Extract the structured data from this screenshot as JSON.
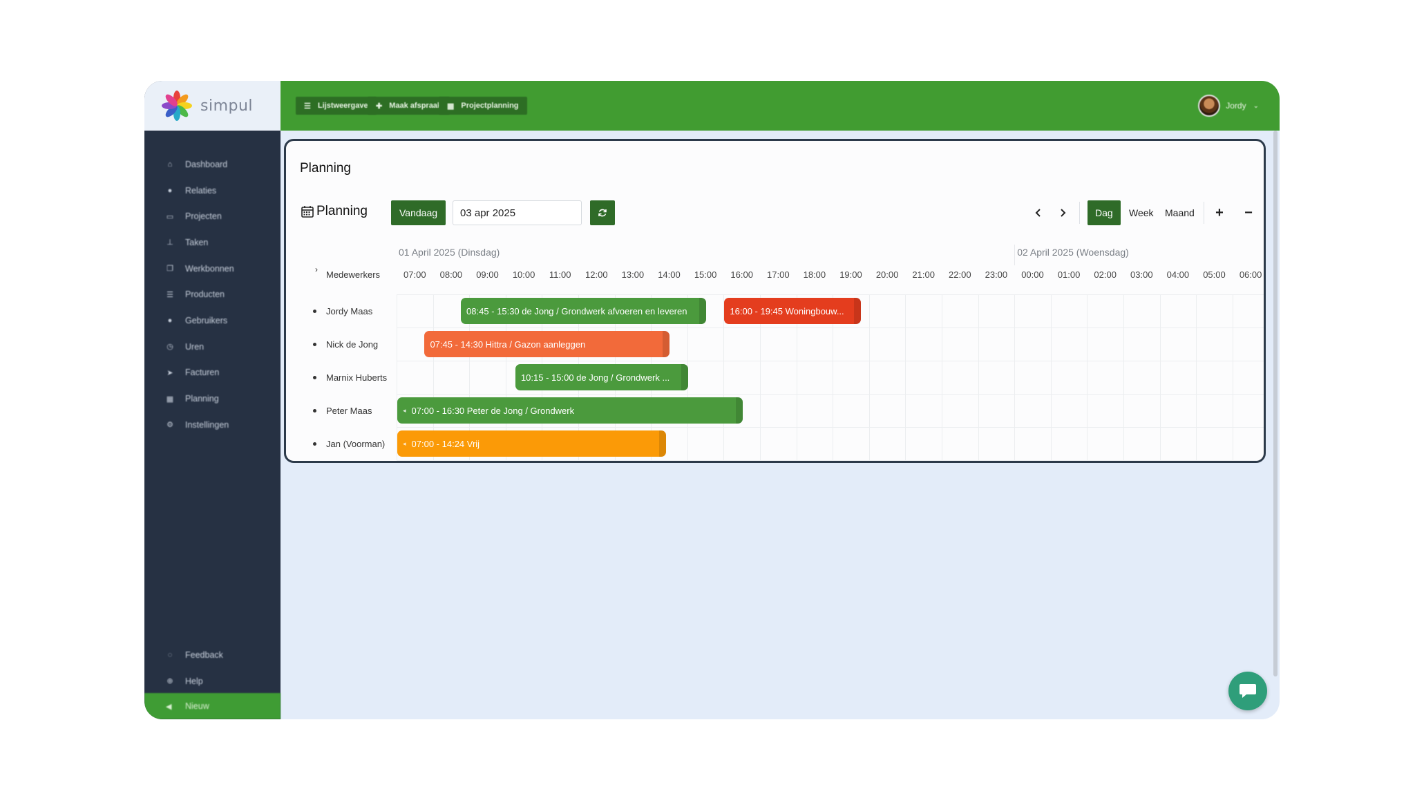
{
  "brand": {
    "name": "simpul"
  },
  "topbar": {
    "buttons": [
      {
        "label": "Lijstweergave",
        "icon": "list-icon"
      },
      {
        "label": "Maak afspraak",
        "icon": "plus-icon"
      },
      {
        "label": "Projectplanning",
        "icon": "calendar-icon"
      }
    ],
    "user": {
      "name": "Jordy"
    }
  },
  "sidebar": {
    "items": [
      {
        "label": "Dashboard",
        "icon": "home-icon"
      },
      {
        "label": "Relaties",
        "icon": "user-icon"
      },
      {
        "label": "Projecten",
        "icon": "inbox-icon"
      },
      {
        "label": "Taken",
        "icon": "pin-icon"
      },
      {
        "label": "Werkbonnen",
        "icon": "copy-icon"
      },
      {
        "label": "Producten",
        "icon": "list-icon"
      },
      {
        "label": "Gebruikers",
        "icon": "users-icon"
      },
      {
        "label": "Uren",
        "icon": "clock-icon"
      },
      {
        "label": "Facturen",
        "icon": "send-icon"
      },
      {
        "label": "Planning",
        "icon": "calendar-icon"
      },
      {
        "label": "Instellingen",
        "icon": "gear-icon"
      }
    ],
    "bottom": [
      {
        "label": "Feedback",
        "icon": "chat-icon"
      },
      {
        "label": "Help",
        "icon": "help-icon"
      }
    ],
    "new": {
      "label": "Nieuw",
      "icon": "megaphone-icon"
    }
  },
  "page": {
    "title": "Planning"
  },
  "toolbar": {
    "title": "Planning",
    "today": "Vandaag",
    "date": "03 apr 2025",
    "views": {
      "day": "Dag",
      "week": "Week",
      "month": "Maand"
    },
    "active_view": "Dag"
  },
  "scheduler": {
    "resource_header": "Medewerkers",
    "days": [
      "01 April 2025 (Dinsdag)",
      "02 April 2025 (Woensdag)"
    ],
    "hours": [
      "07:00",
      "08:00",
      "09:00",
      "10:00",
      "11:00",
      "12:00",
      "13:00",
      "14:00",
      "15:00",
      "16:00",
      "17:00",
      "18:00",
      "19:00",
      "20:00",
      "21:00",
      "22:00",
      "23:00",
      "00:00",
      "01:00",
      "02:00",
      "03:00",
      "04:00",
      "05:00",
      "06:00"
    ],
    "resources": [
      "Jordy Maas",
      "Nick de Jong",
      "Marnix Huberts",
      "Peter Maas",
      "Jan (Voorman)"
    ],
    "events": [
      {
        "resource": 0,
        "start": 8.75,
        "end": 15.5,
        "label": "08:45 - 15:30 de Jong / Grondwerk afvoeren en leveren",
        "color": "#4b9a3d"
      },
      {
        "resource": 0,
        "start": 16.0,
        "end": 19.75,
        "label": "16:00 - 19:45 Woningbouw...",
        "color": "#e43d1e"
      },
      {
        "resource": 1,
        "start": 7.75,
        "end": 14.5,
        "label": "07:45 - 14:30 Hittra / Gazon aanleggen",
        "color": "#f26a3a"
      },
      {
        "resource": 2,
        "start": 10.25,
        "end": 15.0,
        "label": "10:15 - 15:00 de Jong / Grondwerk ...",
        "color": "#4b9a3d"
      },
      {
        "resource": 3,
        "start": 7.0,
        "end": 16.5,
        "label": "07:00 - 16:30 Peter de Jong / Grondwerk",
        "color": "#4b9a3d",
        "continues_left": true
      },
      {
        "resource": 4,
        "start": 7.0,
        "end": 14.4,
        "label": "07:00 - 14:24 Vrij",
        "color": "#fb9a07",
        "continues_left": true
      }
    ]
  }
}
